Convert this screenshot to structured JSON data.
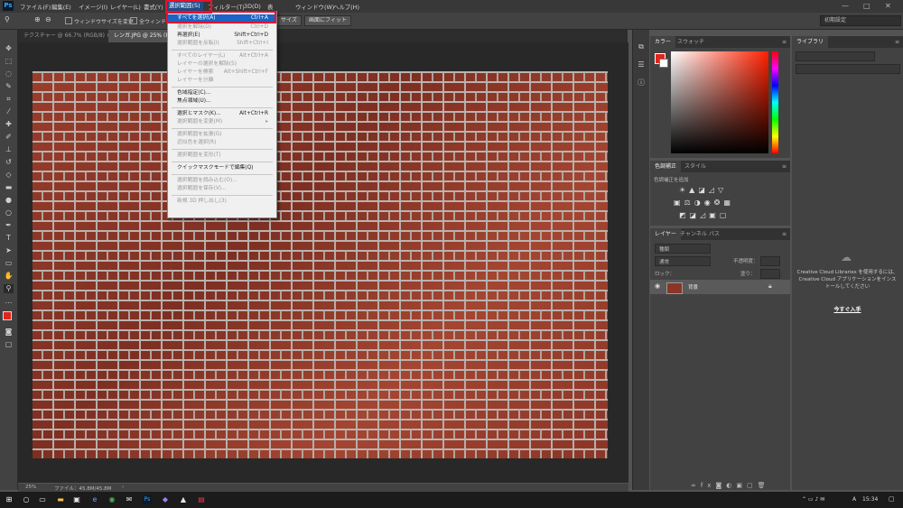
{
  "app": {
    "logo": "Ps"
  },
  "menubar": {
    "items": [
      "ファイル(F)",
      "編集(E)",
      "イメージ(I)",
      "レイヤー(L)",
      "書式(Y)",
      "選択範囲(S)",
      "フィルター(T)",
      "3D(D)",
      "表",
      "ウィンドウ(W)",
      "ヘルプ(H)"
    ],
    "controls": [
      "—",
      "□",
      "✕"
    ]
  },
  "options": {
    "resize_windows": "ウィンドウサイズを変更",
    "all_windows": "全ウィンドウ",
    "fit_size": "サイズ",
    "fit_screen": "画面にフィット",
    "workspace": "初期設定"
  },
  "tabs": [
    {
      "label": "テクスチャー @ 66.7% (RGB/8) ✕"
    },
    {
      "label": "レンガ.JPG @ 25% (RGB/8)"
    }
  ],
  "status": {
    "zoom": "25%",
    "file": "ファイル：45.8M/45.8M",
    "arrow": "›"
  },
  "dropdown": {
    "items": [
      {
        "label": "すべてを選択(A)",
        "shortcut": "Ctrl+A",
        "state": "highlighted"
      },
      {
        "label": "選択を解除(D)",
        "shortcut": "Ctrl+D",
        "state": "disabled"
      },
      {
        "label": "再選択(E)",
        "shortcut": "Shift+Ctrl+D",
        "state": "enabled"
      },
      {
        "label": "選択範囲を反転(I)",
        "shortcut": "Shift+Ctrl+I",
        "state": "disabled"
      },
      {
        "label": "すべてのレイヤー(L)",
        "shortcut": "Alt+Ctrl+A",
        "state": "disabled"
      },
      {
        "label": "レイヤーの選択を解除(S)",
        "shortcut": "",
        "state": "disabled"
      },
      {
        "label": "レイヤーを検索",
        "shortcut": "Alt+Shift+Ctrl+F",
        "state": "disabled"
      },
      {
        "label": "レイヤーを分離",
        "shortcut": "",
        "state": "disabled"
      },
      {
        "label": "色域指定(C)...",
        "shortcut": "",
        "state": "enabled"
      },
      {
        "label": "焦点領域(U)...",
        "shortcut": "",
        "state": "enabled"
      },
      {
        "label": "選択とマスク(K)...",
        "shortcut": "Alt+Ctrl+R",
        "state": "enabled"
      },
      {
        "label": "選択範囲を変更(M)",
        "shortcut": "▸",
        "state": "disabled"
      },
      {
        "label": "選択範囲を拡張(G)",
        "shortcut": "",
        "state": "disabled"
      },
      {
        "label": "近似色を選択(R)",
        "shortcut": "",
        "state": "disabled"
      },
      {
        "label": "選択範囲を変形(T)",
        "shortcut": "",
        "state": "disabled"
      },
      {
        "label": "クイックマスクモードで編集(Q)",
        "shortcut": "",
        "state": "enabled"
      },
      {
        "label": "選択範囲を読み込む(O)...",
        "shortcut": "",
        "state": "disabled"
      },
      {
        "label": "選択範囲を保存(V)...",
        "shortcut": "",
        "state": "disabled"
      },
      {
        "label": "新規 3D 押し出し(3)",
        "shortcut": "",
        "state": "disabled"
      }
    ]
  },
  "color_panel": {
    "tabs": [
      "カラー",
      "スウォッチ"
    ],
    "foreground": "#e3241b"
  },
  "adjust_panel": {
    "tabs": [
      "色調補正",
      "スタイル"
    ],
    "add_label": "色調補正を追加"
  },
  "layers_panel": {
    "tabs": [
      "レイヤー",
      "チャンネル",
      "パス"
    ],
    "kind": "種類",
    "blend": "通常",
    "opacity_label": "不透明度：",
    "lock_label": "ロック：",
    "fill_label": "塗り：",
    "layer_name": "背景"
  },
  "library_panel": {
    "tab": "ライブラリ",
    "message": [
      "Creative Cloud Libraries を使用するには、",
      "Creative Cloud アプリケーションをインス",
      "トールしてください"
    ],
    "link": "今すぐ入手"
  },
  "taskbar": {
    "time": "15:34",
    "lang": "A"
  }
}
